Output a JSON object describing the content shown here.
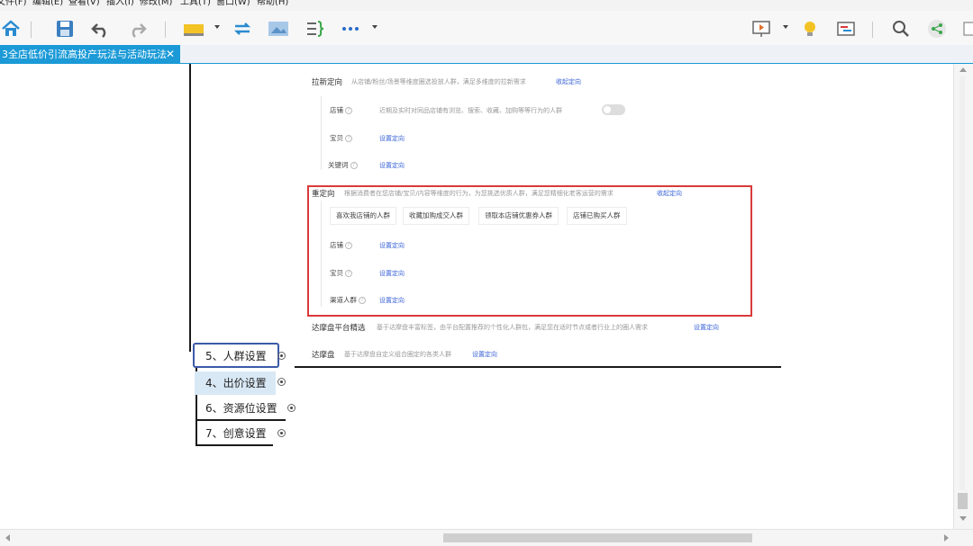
{
  "menu": [
    "文件(F)",
    "编辑(E)",
    "查看(V)",
    "插入(I)",
    "修改(M)",
    "工具(T)",
    "窗口(W)",
    "帮助(H)"
  ],
  "toolbar": {
    "icons": [
      "home-icon",
      "save-icon",
      "undo-icon",
      "redo-icon",
      "topic-style-icon",
      "relationship-icon",
      "image-icon",
      "boundary-icon",
      "more-icon",
      "presentation-icon",
      "idea-icon",
      "gantt-icon",
      "search-icon",
      "share-icon"
    ]
  },
  "tab": {
    "title": "3全店低价引流高投产玩法与活动玩法",
    "close": "✕"
  },
  "shot": {
    "lx_title": "拉新定向",
    "lx_desc": "从店铺/粉丝/场景等维度圈选投放人群，满足多维度的拉新需求",
    "lx_collapse": "收起定向",
    "lx_shop": "店铺",
    "lx_shop_desc": "近期及实时对同品店铺有浏览、搜索、收藏、加购等等行为的人群",
    "lx_item": "宝贝",
    "lx_item_link": "设置定向",
    "lx_kw": "关键词",
    "lx_kw_link": "设置定向",
    "cdx_title": "重定向",
    "cdx_desc": "根据消费者在您店铺/宝贝/内容等维度的行为，为您挑选优质人群，满足您精细化老客运营的需求",
    "cdx_collapse": "收起定向",
    "chips": [
      "喜欢我店铺的人群",
      "收藏加购成交人群",
      "领取本店铺优惠券人群",
      "店铺已购买人群"
    ],
    "cdx_shop": "店铺",
    "cdx_shop_link": "设置定向",
    "cdx_item": "宝贝",
    "cdx_item_link": "设置定向",
    "cdx_channel": "渠道人群",
    "cdx_channel_link": "设置定向",
    "dmp_title": "达摩盘平台精选",
    "dmp_desc": "基于达摩盘丰富标签，由平台配置推荐的个性化人群包，满足您在适时节点或者行业上的圈人需求",
    "dmp_link": "设置定向",
    "dm_title": "达摩盘",
    "dm_desc": "基于达摩盘自定义组合圈定的各类人群",
    "dm_link": "设置定向",
    "qmark": "?"
  },
  "nodes": [
    "5、人群设置",
    "4、出价设置",
    "6、资源位设置",
    "7、创意设置"
  ],
  "colors": {
    "accent": "#1b9ad7",
    "highlight_border": "#d93a3a",
    "selected_node_border": "#3c5aa8",
    "link": "#3a63d6"
  }
}
